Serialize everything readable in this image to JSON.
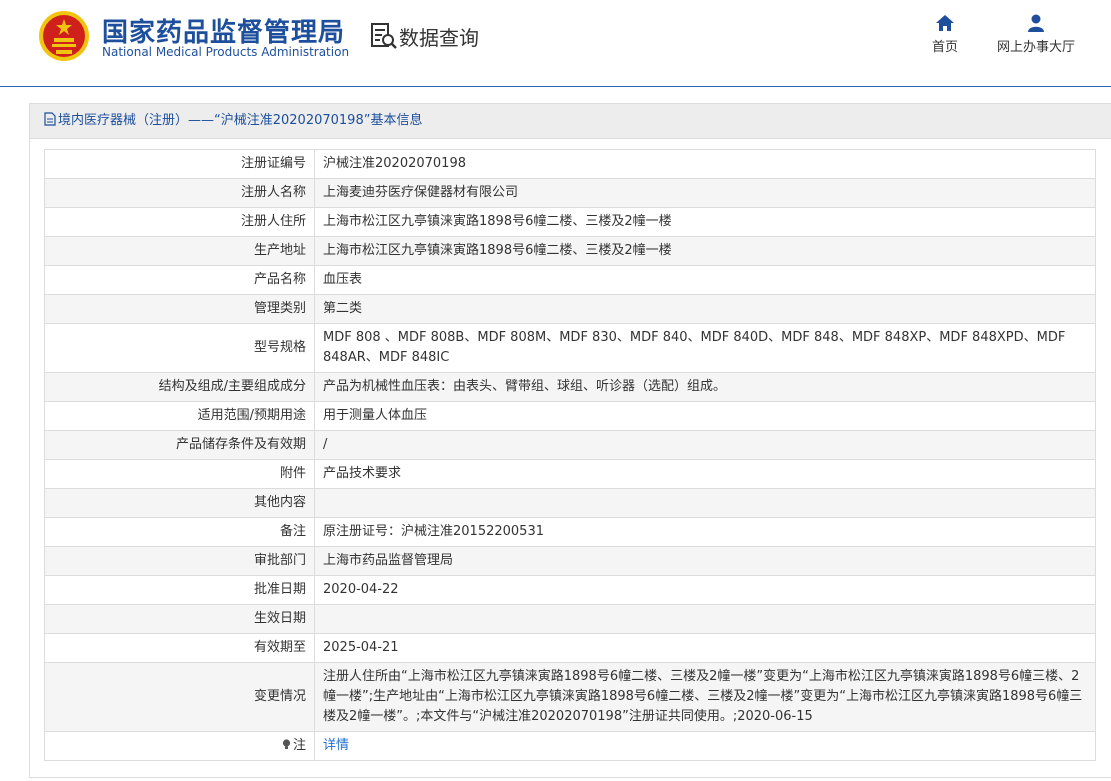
{
  "header": {
    "site_name_cn": "国家药品监督管理局",
    "site_name_en": "National Medical Products Administration",
    "section_title": "数据查询",
    "nav": [
      {
        "label": "首页",
        "icon": "home-icon"
      },
      {
        "label": "网上办事大厅",
        "icon": "user-icon"
      }
    ],
    "colors": {
      "brand_blue": "#1d4f9d",
      "emblem_red": "#d0201c",
      "emblem_gold": "#f1c40f"
    }
  },
  "panel": {
    "title": "境内医疗器械（注册）——“沪械注准20202070198”基本信息",
    "rows": [
      {
        "label": "注册证编号",
        "value": "沪械注准20202070198"
      },
      {
        "label": "注册人名称",
        "value": "上海麦迪芬医疗保健器材有限公司"
      },
      {
        "label": "注册人住所",
        "value": "上海市松江区九亭镇涞寅路1898号6幢二楼、三楼及2幢一楼"
      },
      {
        "label": "生产地址",
        "value": "上海市松江区九亭镇涞寅路1898号6幢二楼、三楼及2幢一楼"
      },
      {
        "label": "产品名称",
        "value": "血压表"
      },
      {
        "label": "管理类别",
        "value": "第二类"
      },
      {
        "label": "型号规格",
        "value": "MDF 808 、MDF 808B、MDF 808M、MDF 830、MDF 840、MDF 840D、MDF 848、MDF 848XP、MDF 848XPD、MDF 848AR、MDF 848IC"
      },
      {
        "label": "结构及组成/主要组成成分",
        "value": "产品为机械性血压表：由表头、臂带组、球组、听诊器（选配）组成。"
      },
      {
        "label": "适用范围/预期用途",
        "value": "用于测量人体血压"
      },
      {
        "label": "产品储存条件及有效期",
        "value": "/"
      },
      {
        "label": "附件",
        "value": "产品技术要求"
      },
      {
        "label": "其他内容",
        "value": ""
      },
      {
        "label": "备注",
        "value": "原注册证号：沪械注准20152200531"
      },
      {
        "label": "审批部门",
        "value": "上海市药品监督管理局"
      },
      {
        "label": "批准日期",
        "value": "2020-04-22"
      },
      {
        "label": "生效日期",
        "value": ""
      },
      {
        "label": "有效期至",
        "value": "2025-04-21"
      },
      {
        "label": "变更情况",
        "value": "注册人住所由“上海市松江区九亭镇涞寅路1898号6幢二楼、三楼及2幢一楼”变更为“上海市松江区九亭镇涞寅路1898号6幢三楼、2幢一楼”;生产地址由“上海市松江区九亭镇涞寅路1898号6幢二楼、三楼及2幢一楼”变更为“上海市松江区九亭镇涞寅路1898号6幢三楼及2幢一楼”。;本文件与“沪械注准20202070198”注册证共同使用。;2020-06-15"
      }
    ],
    "note": {
      "label": "注",
      "link_text": "详情",
      "icon": "lightbulb-icon"
    }
  }
}
